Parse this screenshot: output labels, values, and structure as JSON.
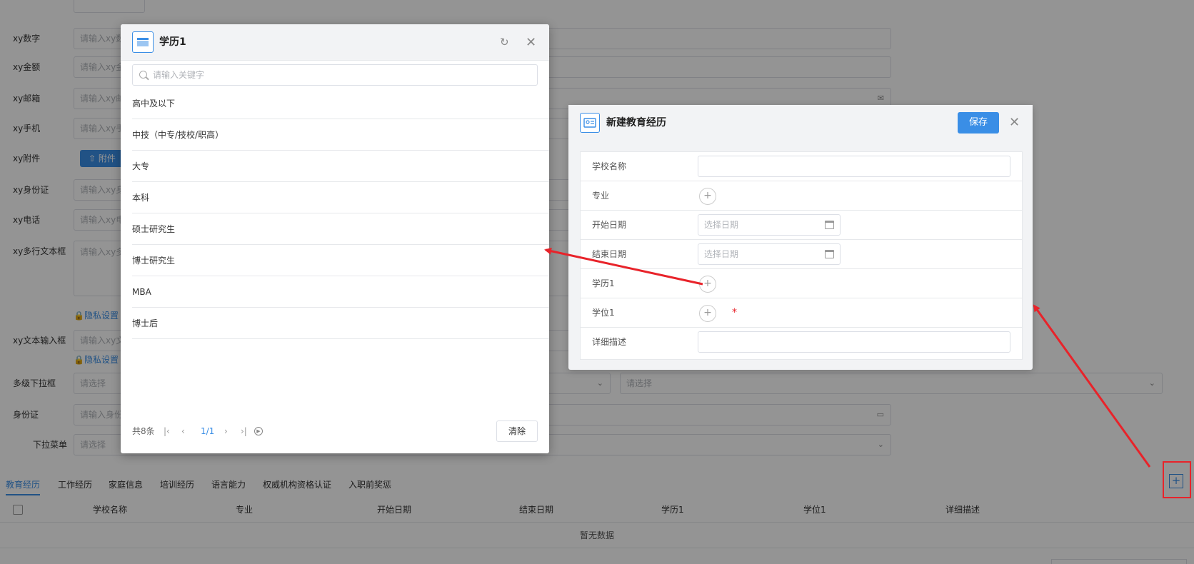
{
  "form": {
    "rows": [
      {
        "label": "xy数字",
        "placeholder": "请输入xy数"
      },
      {
        "label": "xy金额",
        "placeholder": "请输入xy金"
      },
      {
        "label": "xy邮箱",
        "placeholder": "请输入xy邮"
      },
      {
        "label": "xy手机",
        "placeholder": "请输入xy手"
      },
      {
        "label": "xy附件",
        "button": "附件"
      },
      {
        "label": "xy身份证",
        "placeholder": "请输入xy身"
      },
      {
        "label": "xy电话",
        "placeholder": "请输入xy电"
      },
      {
        "label": "xy多行文本框",
        "placeholder": "请输入xy多"
      },
      {
        "label": "xy文本输入框",
        "placeholder": "请输入xy文"
      },
      {
        "label": "多级下拉框",
        "placeholder": "请选择",
        "placeholder2": "请选择"
      },
      {
        "label": "身份证",
        "placeholder": "请输入身份"
      },
      {
        "label": "下拉菜单",
        "placeholder": "请选择"
      }
    ],
    "privacy_label": "隐私设置",
    "privacy_label_2": "隐私设置"
  },
  "tabs": [
    "教育经历",
    "工作经历",
    "家庭信息",
    "培训经历",
    "语言能力",
    "权威机构资格认证",
    "入职前奖惩"
  ],
  "table": {
    "columns": [
      "学校名称",
      "专业",
      "开始日期",
      "结束日期",
      "学历1",
      "学位1",
      "详细描述"
    ],
    "empty_text": "暂无数据"
  },
  "edu_modal": {
    "title": "新建教育经历",
    "save_label": "保存",
    "fields": {
      "school": "学校名称",
      "major": "专业",
      "start": "开始日期",
      "end": "结束日期",
      "degree1": "学历1",
      "degree2": "学位1",
      "desc": "详细描述"
    },
    "date_placeholder": "选择日期",
    "date_placeholder_2": "选择日期",
    "required_mark": "*"
  },
  "picker": {
    "title": "学历1",
    "search_placeholder": "请输入关键字",
    "items": [
      "高中及以下",
      "中技（中专/技校/职高）",
      "大专",
      "本科",
      "硕士研究生",
      "博士研究生",
      "MBA",
      "博士后"
    ],
    "total": "共8条",
    "page": "1/1",
    "clear_label": "清除"
  },
  "colors": {
    "accent": "#3a8ee6",
    "annotation": "#e8232a"
  }
}
